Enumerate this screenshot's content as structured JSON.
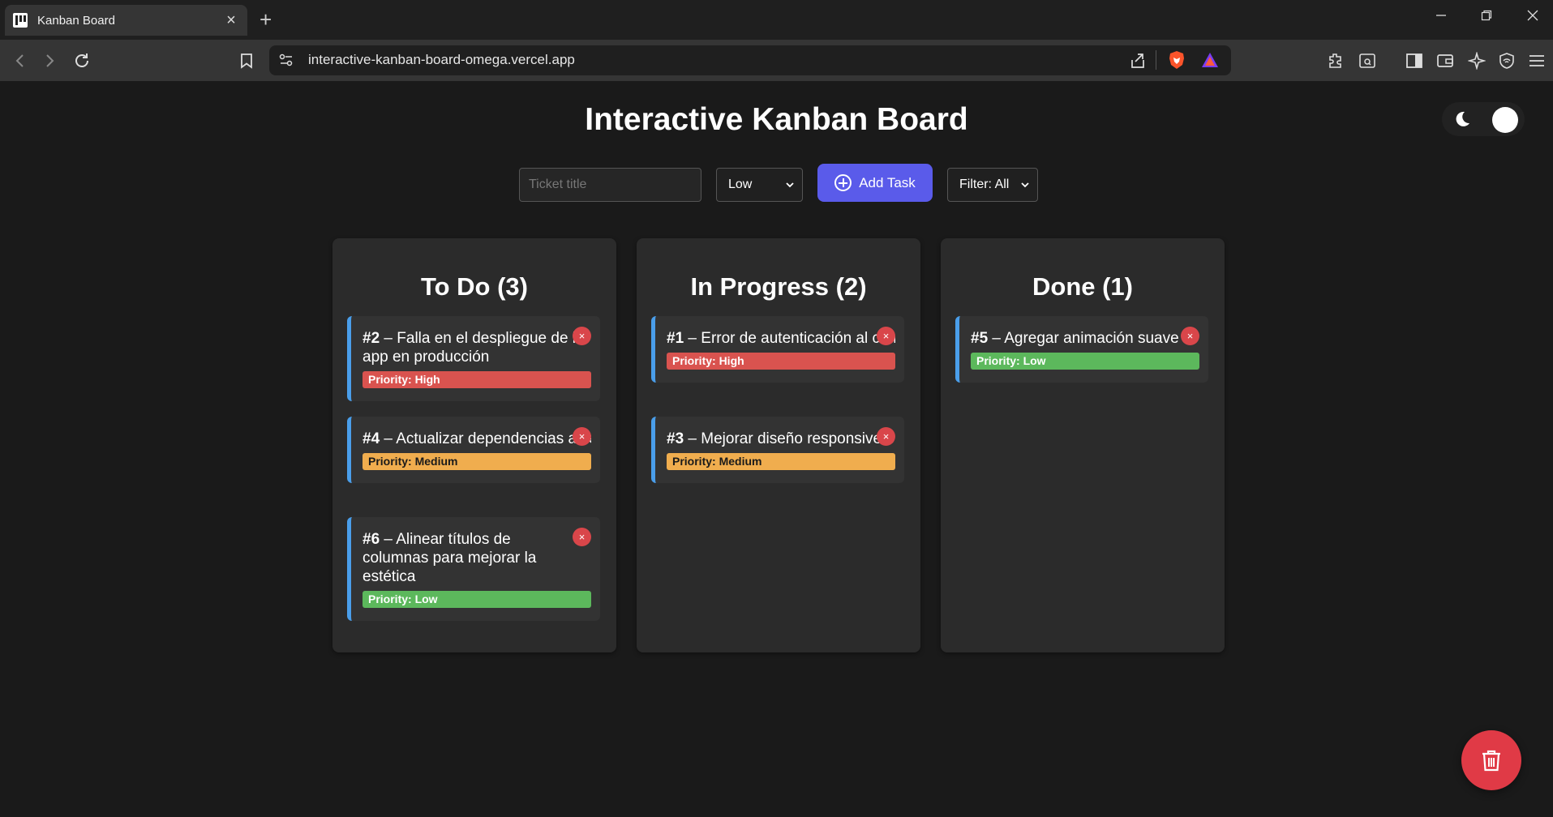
{
  "browser": {
    "tab_title": "Kanban Board",
    "tab_close": "×",
    "new_tab": "+",
    "url": "interactive-kanban-board-omega.vercel.app"
  },
  "app": {
    "title": "Interactive Kanban Board",
    "input_placeholder": "Ticket title",
    "priority_selected": "Low",
    "add_button_label": "Add Task",
    "filter_selected": "Filter: All",
    "theme": "dark"
  },
  "columns": [
    {
      "title": "To Do (3)",
      "cards": [
        {
          "id": "#2",
          "text": " – Falla en el despliegue de la app en producción",
          "priority": "Priority: High"
        },
        {
          "id": "#4",
          "text": " – Actualizar dependencias a versiones más recientes",
          "priority": "Priority: Medium"
        },
        {
          "id": "#6",
          "text": " – Alinear títulos de columnas para mejorar la estética",
          "priority": "Priority: Low"
        }
      ]
    },
    {
      "title": "In Progress (2)",
      "cards": [
        {
          "id": "#1",
          "text": " – Error de autenticación al cambiar contraseña",
          "priority": "Priority: High"
        },
        {
          "id": "#3",
          "text": " – Mejorar diseño responsive en pantallas de tablet",
          "priority": "Priority: Medium"
        }
      ]
    },
    {
      "title": "Done (1)",
      "cards": [
        {
          "id": "#5",
          "text": " – Agregar animación suave al arrastrar tickets",
          "priority": "Priority: Low"
        }
      ]
    }
  ],
  "card_delete_glyph": "×",
  "colors": {
    "accent": "#5a5bea",
    "priority_high": "#d9534f",
    "priority_medium": "#f0ad4e",
    "priority_low": "#5cb85c",
    "trash": "#e03a46"
  }
}
